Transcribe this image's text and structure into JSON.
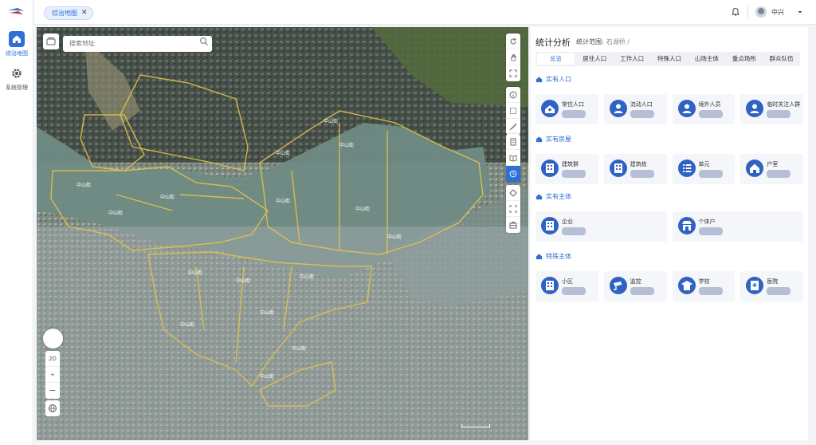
{
  "tabs_bar": {
    "tab_label": "综治地图",
    "close": "✕"
  },
  "sidebar": {
    "items": [
      {
        "label": "综治地图",
        "icon": "home-icon"
      },
      {
        "label": "系统管理",
        "icon": "gear-icon"
      }
    ]
  },
  "header": {
    "user_name": "中兴",
    "icons": [
      "bell-icon",
      "avatar",
      "caret-down-icon"
    ]
  },
  "map": {
    "search_placeholder": "搜索地址",
    "view_mode_label": "2D",
    "zoom_in": "+",
    "zoom_out": "−"
  },
  "panel": {
    "title": "统计分析",
    "range_label": "统计范围:",
    "range_value": "石湖桥 /",
    "tabs": [
      "总览",
      "居住人口",
      "工作人口",
      "特殊人口",
      "山场主体",
      "重点场所",
      "群众队伍"
    ],
    "active_tab": 0,
    "sections": [
      {
        "title": "实有人口",
        "cards": [
          {
            "label": "常住人口",
            "icon": "house-person-icon"
          },
          {
            "label": "流动人口",
            "icon": "person-icon"
          },
          {
            "label": "境外人员",
            "icon": "person-icon"
          },
          {
            "label": "临时关注人群",
            "icon": "person-icon"
          }
        ]
      },
      {
        "title": "实有房屋",
        "cards": [
          {
            "label": "建筑群",
            "icon": "building-icon"
          },
          {
            "label": "建筑栋",
            "icon": "building-icon"
          },
          {
            "label": "单元",
            "icon": "list-icon"
          },
          {
            "label": "户室",
            "icon": "home-icon"
          }
        ]
      },
      {
        "title": "实有主体",
        "cards": [
          {
            "label": "企业",
            "icon": "building-icon"
          },
          {
            "label": "个体户",
            "icon": "shop-icon"
          }
        ]
      },
      {
        "title": "特殊主体",
        "cards": [
          {
            "label": "小区",
            "icon": "building-icon"
          },
          {
            "label": "监控",
            "icon": "camera-icon"
          },
          {
            "label": "学校",
            "icon": "school-icon"
          },
          {
            "label": "医院",
            "icon": "hospital-icon"
          }
        ]
      }
    ]
  },
  "colors": {
    "accent": "#2f6fd6",
    "icon_fill": "#2f62c2",
    "boundary": "#e3c24a",
    "card_bg": "#f4f6fa"
  }
}
